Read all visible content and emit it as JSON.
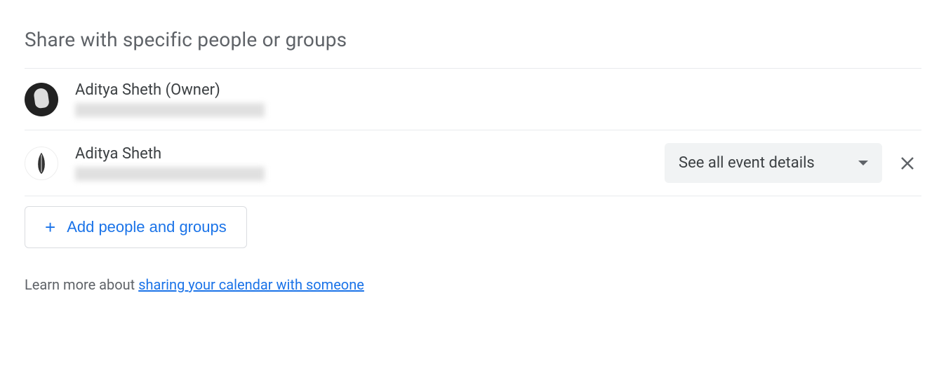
{
  "section": {
    "title": "Share with specific people or groups"
  },
  "people": [
    {
      "name": "Aditya Sheth (Owner)",
      "is_owner": true
    },
    {
      "name": "Aditya Sheth",
      "is_owner": false,
      "permission": "See all event details"
    }
  ],
  "actions": {
    "add_button": "Add people and groups"
  },
  "footer": {
    "learn_more_prefix": "Learn more about ",
    "learn_more_link": "sharing your calendar with someone"
  }
}
